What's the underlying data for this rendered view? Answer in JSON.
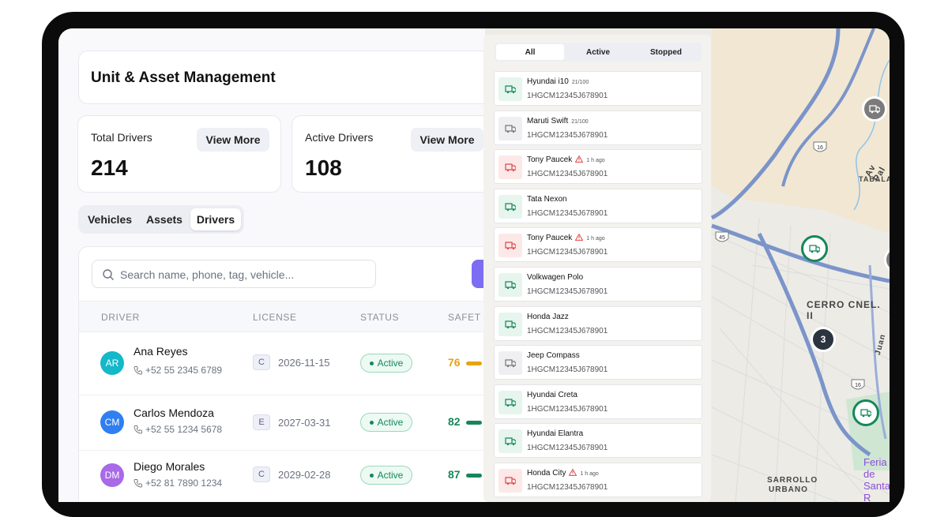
{
  "page": {
    "title": "Unit & Asset Management"
  },
  "stats": [
    {
      "label": "Total Drivers",
      "value": "214",
      "button": "View More"
    },
    {
      "label": "Active Drivers",
      "value": "108",
      "button": "View More"
    }
  ],
  "tabs": [
    "Vehicles",
    "Assets",
    "Drivers"
  ],
  "active_tab": "Drivers",
  "search": {
    "placeholder": "Search name, phone, tag, vehicle..."
  },
  "table": {
    "columns": [
      "DRIVER",
      "LICENSE",
      "STATUS",
      "SAFET"
    ],
    "rows": [
      {
        "initials": "AR",
        "name": "Ana Reyes",
        "phone": "+52 55 2345 6789",
        "license_class": "C",
        "license_exp": "2026-11-15",
        "status": "Active",
        "score": "76",
        "score_color": "#e8a30c",
        "avatar_color": "#14b8c9"
      },
      {
        "initials": "CM",
        "name": "Carlos Mendoza",
        "phone": "+52 55 1234 5678",
        "license_class": "E",
        "license_exp": "2027-03-31",
        "status": "Active",
        "score": "82",
        "score_color": "#16875a",
        "avatar_color": "#2f7ff0"
      },
      {
        "initials": "DM",
        "name": "Diego Morales",
        "phone": "+52 81 7890 1234",
        "license_class": "C",
        "license_exp": "2029-02-28",
        "status": "Active",
        "score": "87",
        "score_color": "#16875a",
        "avatar_color": "#a86ae8"
      }
    ]
  },
  "vehicle_panel": {
    "filters": [
      "All",
      "Active",
      "Stopped"
    ],
    "active_filter": "All",
    "vehicles": [
      {
        "name": "Hyundai i10",
        "meta": "21/100",
        "vin": "1HGCM12345J678901",
        "state": "active",
        "warning": false
      },
      {
        "name": "Maruti Swift",
        "meta": "21/100",
        "vin": "1HGCM12345J678901",
        "state": "idle",
        "warning": false
      },
      {
        "name": "Tony Paucek",
        "meta": "1 h ago",
        "vin": "1HGCM12345J678901",
        "state": "stopped",
        "warning": true
      },
      {
        "name": "Tata Nexon",
        "meta": "",
        "vin": "1HGCM12345J678901",
        "state": "active",
        "warning": false
      },
      {
        "name": "Tony Paucek",
        "meta": "1 h ago",
        "vin": "1HGCM12345J678901",
        "state": "stopped",
        "warning": true
      },
      {
        "name": "Volkwagen Polo",
        "meta": "",
        "vin": "1HGCM12345J678901",
        "state": "active",
        "warning": false
      },
      {
        "name": "Honda Jazz",
        "meta": "",
        "vin": "1HGCM12345J678901",
        "state": "active",
        "warning": false
      },
      {
        "name": "Jeep Compass",
        "meta": "",
        "vin": "1HGCM12345J678901",
        "state": "idle",
        "warning": false
      },
      {
        "name": "Hyundai Creta",
        "meta": "",
        "vin": "1HGCM12345J678901",
        "state": "active",
        "warning": false
      },
      {
        "name": "Hyundai Elantra",
        "meta": "",
        "vin": "1HGCM12345J678901",
        "state": "active",
        "warning": false
      },
      {
        "name": "Honda City",
        "meta": "1 h ago",
        "vin": "1HGCM12345J678901",
        "state": "stopped",
        "warning": true
      }
    ]
  },
  "map": {
    "labels": [
      "CERRO CNEL. II",
      "Feria de Santa R",
      "SARROLLO",
      "URBANO",
      "Av Pal",
      "TABALA",
      "Juan"
    ],
    "road_shields": [
      "16",
      "45",
      "16"
    ],
    "cluster_count": "3"
  },
  "colors": {
    "active": "#16875a",
    "stopped": "#e04848",
    "idle": "#777777",
    "accent": "#7c6df2"
  }
}
